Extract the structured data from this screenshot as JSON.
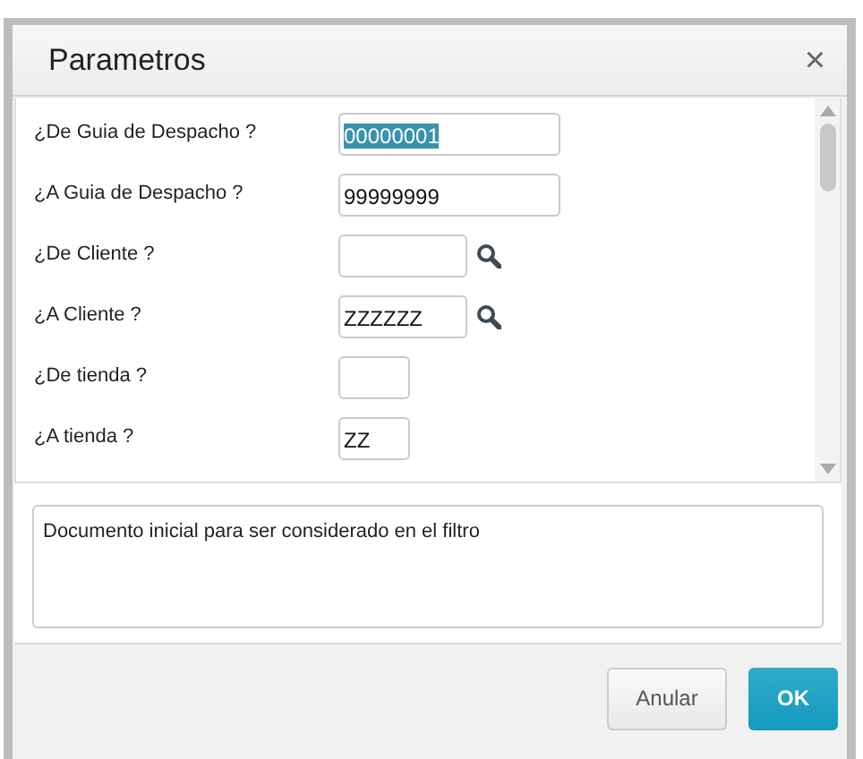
{
  "dialog": {
    "title": "Parametros",
    "close": "×"
  },
  "fields": [
    {
      "label": "¿De Guia de Despacho ?",
      "value": "00000001",
      "kind": "long",
      "highlighted": true,
      "lookup": false
    },
    {
      "label": "¿A Guia de Despacho ?",
      "value": "99999999",
      "kind": "long",
      "highlighted": false,
      "lookup": false
    },
    {
      "label": "¿De Cliente ?",
      "kind": "medium",
      "lookup": true
    },
    {
      "label": "¿A Cliente ?",
      "value": "ZZZZZZ",
      "kind": "medium",
      "highlighted": false,
      "lookup": true
    },
    {
      "label": "¿De tienda ?",
      "kind": "short",
      "lookup": false
    },
    {
      "label": "¿A tienda ?",
      "value": "ZZ",
      "kind": "short",
      "highlighted": false,
      "lookup": false
    }
  ],
  "help_text": "Documento inicial para ser considerado en el filtro",
  "buttons": [
    {
      "label": "Anular",
      "kind": "secondary"
    },
    {
      "label": "OK",
      "kind": "primary"
    }
  ]
}
